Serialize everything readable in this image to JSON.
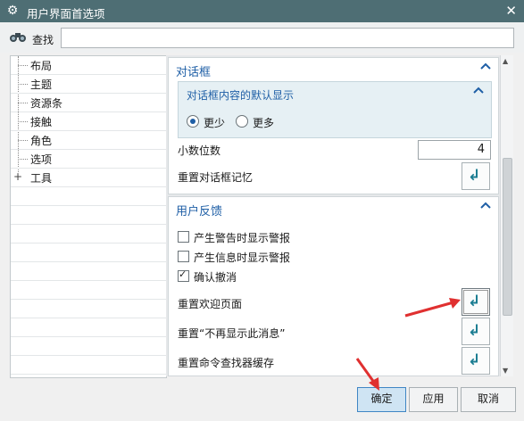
{
  "window": {
    "title": "用户界面首选项",
    "close_glyph": "✕",
    "gear_glyph": "⚙"
  },
  "search": {
    "icon": "binoculars-icon",
    "label": "查找",
    "value": ""
  },
  "tree": {
    "items": [
      {
        "label": "布局",
        "expandable": false
      },
      {
        "label": "主题",
        "expandable": false
      },
      {
        "label": "资源条",
        "expandable": false
      },
      {
        "label": "接触",
        "expandable": false
      },
      {
        "label": "角色",
        "expandable": false
      },
      {
        "label": "选项",
        "expandable": false
      },
      {
        "label": "工具",
        "expandable": true
      }
    ]
  },
  "dialog_section": {
    "title": "对话框",
    "subsection_title": "对话框内容的默认显示",
    "radio_options": [
      {
        "label": "更少",
        "selected": true
      },
      {
        "label": "更多",
        "selected": false
      }
    ],
    "decimal_label": "小数位数",
    "decimal_value": "4",
    "reset_memory_label": "重置对话框记忆"
  },
  "feedback_section": {
    "title": "用户反馈",
    "checkboxes": [
      {
        "label": "产生警告时显示警报",
        "checked": false
      },
      {
        "label": "产生信息时显示警报",
        "checked": false
      },
      {
        "label": "确认撤消",
        "checked": true
      }
    ],
    "reset_rows": [
      {
        "label": "重置欢迎页面"
      },
      {
        "label": "重置“不再显示此消息”"
      },
      {
        "label": "重置命令查找器缓存"
      }
    ]
  },
  "buttons": {
    "ok": "确定",
    "apply": "应用",
    "cancel": "取消"
  },
  "colors": {
    "titlebar": "#4e6e74",
    "section_title": "#1f5fa6",
    "reset_arrow": "#1b7d92",
    "annotation_arrow": "#e03030"
  }
}
